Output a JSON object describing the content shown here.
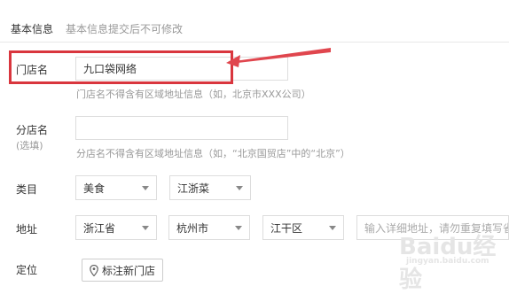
{
  "header": {
    "title": "基本信息",
    "note": "基本信息提交后不可修改"
  },
  "form": {
    "store_name": {
      "label": "门店名",
      "value": "九口袋网络",
      "hint": "门店名不得含有区域地址信息（如，北京市XXX公司）"
    },
    "branch_name": {
      "label": "分店名",
      "sublabel": "(选填)",
      "value": "",
      "hint": "分店名不得含有区域地址信息（如，“北京国贸店”中的“北京”）"
    },
    "category": {
      "label": "类目",
      "primary": "美食",
      "secondary": "江浙菜"
    },
    "address": {
      "label": "地址",
      "province": "浙江省",
      "city": "杭州市",
      "district": "江干区",
      "detail_placeholder": "输入详细地址，请勿重复填写省市"
    },
    "location": {
      "label": "定位",
      "button": "标注新门店"
    }
  },
  "watermark": {
    "text": "Baidu经验",
    "sub": "jingyan.baidu.com"
  },
  "colors": {
    "highlight": "#d9363e",
    "arrow": "#e0464e"
  }
}
